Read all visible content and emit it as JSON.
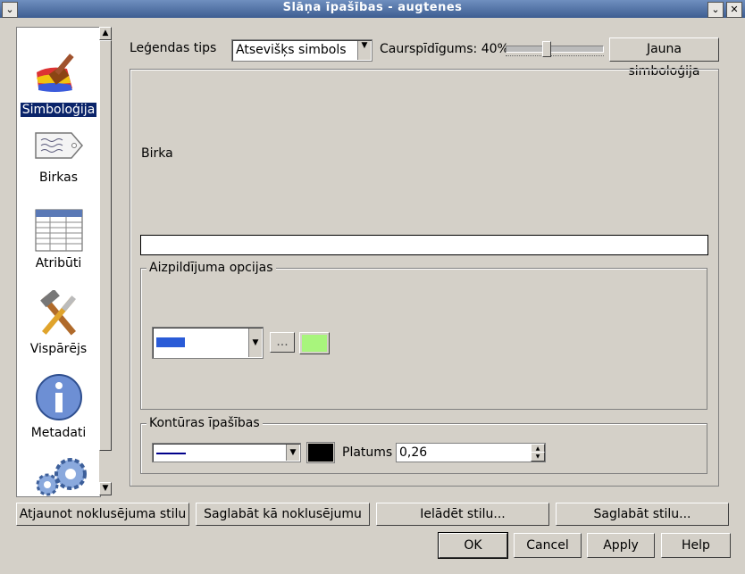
{
  "window": {
    "title": "Slāņa īpašības - augtenes",
    "close": "✕",
    "minimize": "⌄"
  },
  "sidebar": {
    "items": [
      {
        "label": "Simboloģija",
        "icon": "paintbrush-icon",
        "selected": true
      },
      {
        "label": "Birkas",
        "icon": "label-tag-icon",
        "selected": false
      },
      {
        "label": "Atribūti",
        "icon": "table-icon",
        "selected": false
      },
      {
        "label": "Vispārējs",
        "icon": "tools-icon",
        "selected": false
      },
      {
        "label": "Metadati",
        "icon": "info-icon",
        "selected": false
      }
    ],
    "scroll_up": "▲",
    "scroll_down": "▼"
  },
  "toolbar": {
    "legend_type_label": "Leģendas tips",
    "legend_type_value": "Atsevišķs simbols",
    "transparency_label": "Caurspīdīgums: 40%",
    "transparency_value": 0.4,
    "new_symbology_button": "Jauna simboloģija"
  },
  "symbol": {
    "label_caption": "Birka",
    "label_value": ""
  },
  "fill": {
    "group_title": "Aizpildījuma opcijas",
    "style_color": "#2a5bd7",
    "more_button": "...",
    "fill_color": "#a8f57c"
  },
  "outline": {
    "group_title": "Kontūras īpašības",
    "line_color": "#00008b",
    "color": "#000000",
    "width_label": "Platums",
    "width_value": "0,26"
  },
  "bottom": {
    "restore_default_style": "Atjaunot noklusējuma stilu",
    "save_as_default": "Saglabāt kā noklusējumu",
    "load_style": "Ielādēt stilu...",
    "save_style": "Saglabāt stilu...",
    "ok": "OK",
    "cancel": "Cancel",
    "apply": "Apply",
    "help": "Help"
  }
}
